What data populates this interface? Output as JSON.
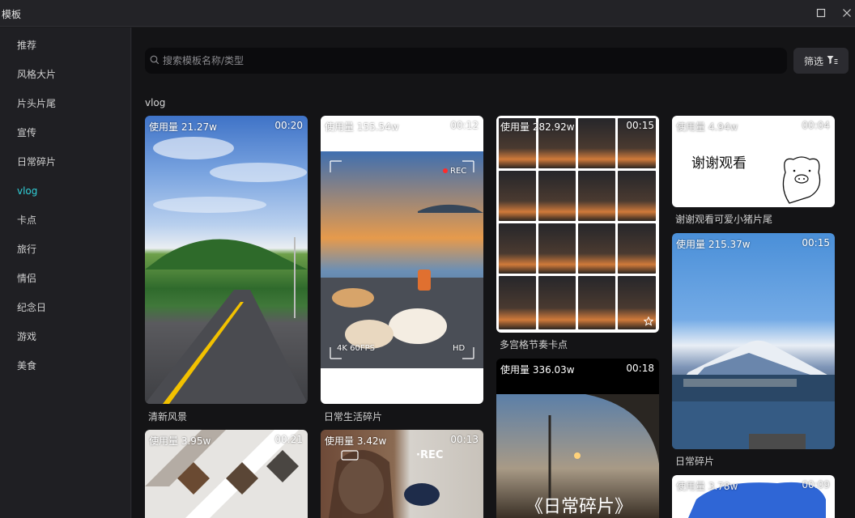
{
  "window": {
    "title": "模板"
  },
  "sidebar": {
    "items": [
      {
        "label": "推荐"
      },
      {
        "label": "风格大片"
      },
      {
        "label": "片头片尾"
      },
      {
        "label": "宣传"
      },
      {
        "label": "日常碎片"
      },
      {
        "label": "vlog"
      },
      {
        "label": "卡点"
      },
      {
        "label": "旅行"
      },
      {
        "label": "情侣"
      },
      {
        "label": "纪念日"
      },
      {
        "label": "游戏"
      },
      {
        "label": "美食"
      }
    ],
    "active": "vlog"
  },
  "search": {
    "placeholder": "搜索模板名称/类型",
    "value": ""
  },
  "filter": {
    "label": "筛选"
  },
  "section": {
    "title": "vlog"
  },
  "cards": [
    {
      "usage": "使用量 21.27w",
      "duration": "00:20",
      "caption": "清新风景"
    },
    {
      "usage": "使用量 155.54w",
      "duration": "00:12",
      "caption": "日常生活碎片",
      "text_rec": "REC",
      "text_fps": "4K 60FPS",
      "text_hd": "HD"
    },
    {
      "usage": "使用量 282.92w",
      "duration": "00:15",
      "caption": "多宫格节奏卡点"
    },
    {
      "usage": "使用量 4.94w",
      "duration": "00:04",
      "caption": "谢谢观看可爱小猪片尾",
      "art_text": "谢谢观看"
    },
    {
      "usage": "使用量 215.37w",
      "duration": "00:15",
      "caption": "日常碎片"
    },
    {
      "usage": "使用量 336.03w",
      "duration": "00:18",
      "art_text": "《日常碎片》"
    },
    {
      "usage": "使用量 3.95w",
      "duration": "00:21"
    },
    {
      "usage": "使用量 3.42w",
      "duration": "00:13",
      "art_text": "·REC"
    },
    {
      "usage": "使用量 3.78w",
      "duration": "00:09"
    }
  ],
  "icons": [
    "window-maximize-icon",
    "window-close-icon",
    "search-icon",
    "filter-icon",
    "star-icon"
  ],
  "colors": {
    "accent": "#31d0d9",
    "background": "#141416",
    "sidebar": "#1f1f23"
  }
}
